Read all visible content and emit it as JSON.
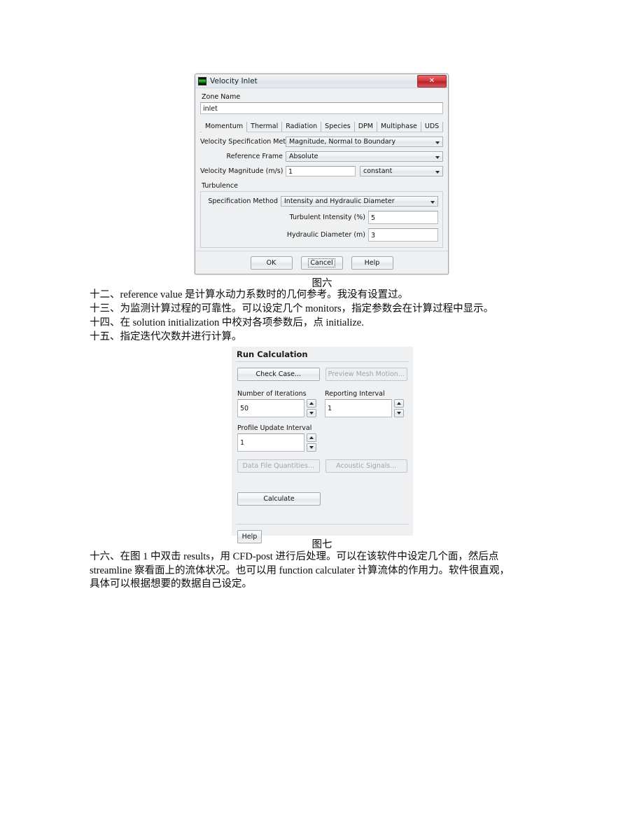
{
  "document": {
    "caption_fig6": "图六",
    "caption_fig7": "图七",
    "paragraphs": [
      "十二、reference value 是计算水动力系数时的几何参考。我没有设置过。",
      "十三、为监测计算过程的可靠性。可以设定几个 monitors，指定参数会在计算过程中显示。",
      "十四、在 solution initialization 中校对各项参数后，点 initialize.",
      "十五、指定迭代次数并进行计算。"
    ],
    "final_paragraph_lines": [
      "十六、在图 1 中双击 results，用 CFD-post 进行后处理。可以在该软件中设定几个面，然后点",
      "streamline 察看面上的流体状况。也可以用 function calculater 计算流体的作用力。软件很直观，",
      "具体可以根据想要的数据自己设定。"
    ]
  },
  "velocity_inlet_dialog": {
    "title": "Velocity Inlet",
    "close_label": "✕",
    "zone_name_label": "Zone Name",
    "zone_name_value": "inlet",
    "tabs": [
      {
        "label": "Momentum",
        "active": true
      },
      {
        "label": "Thermal",
        "active": false
      },
      {
        "label": "Radiation",
        "active": false
      },
      {
        "label": "Species",
        "active": false
      },
      {
        "label": "DPM",
        "active": false
      },
      {
        "label": "Multiphase",
        "active": false
      },
      {
        "label": "UDS",
        "active": false
      }
    ],
    "velocity_spec_method_label": "Velocity Specification Method",
    "velocity_spec_method_value": "Magnitude, Normal to Boundary",
    "reference_frame_label": "Reference Frame",
    "reference_frame_value": "Absolute",
    "velocity_magnitude_label": "Velocity Magnitude (m/s)",
    "velocity_magnitude_value": "1",
    "velocity_magnitude_profile": "constant",
    "turbulence_label": "Turbulence",
    "turb_spec_method_label": "Specification Method",
    "turb_spec_method_value": "Intensity and Hydraulic Diameter",
    "turbulent_intensity_label": "Turbulent Intensity (%)",
    "turbulent_intensity_value": "5",
    "hydraulic_diameter_label": "Hydraulic Diameter (m)",
    "hydraulic_diameter_value": "3",
    "ok_label": "OK",
    "cancel_label": "Cancel",
    "help_label": "Help"
  },
  "run_calculation_panel": {
    "title": "Run Calculation",
    "check_case_label": "Check Case...",
    "preview_mesh_motion_label": "Preview Mesh Motion...",
    "number_of_iterations_label": "Number of Iterations",
    "number_of_iterations_value": "50",
    "reporting_interval_label": "Reporting Interval",
    "reporting_interval_value": "1",
    "profile_update_interval_label": "Profile Update Interval",
    "profile_update_interval_value": "1",
    "data_file_quantities_label": "Data File Quantities...",
    "acoustic_signals_label": "Acoustic Signals...",
    "calculate_label": "Calculate",
    "help_label": "Help"
  }
}
